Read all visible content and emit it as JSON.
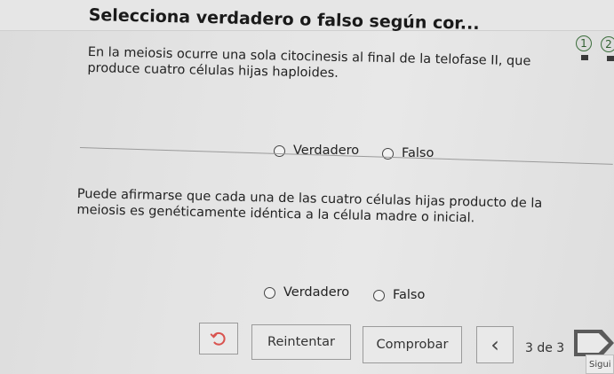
{
  "header": {
    "title": "Selecciona verdadero o falso según cor..."
  },
  "progress": {
    "steps": [
      "1",
      "2"
    ]
  },
  "questions": [
    {
      "text": "En la meiosis ocurre una sola citocinesis al final de la telofase II, que produce cuatro células hijas haploides.",
      "options": [
        "Verdadero",
        "Falso"
      ]
    },
    {
      "text": "Puede afirmarse que cada una de las cuatro células hijas producto de la meiosis es genéticamente idéntica a la célula madre o inicial.",
      "options": [
        "Verdadero",
        "Falso"
      ]
    }
  ],
  "footer": {
    "undo_icon": "undo-icon",
    "retry_label": "Reintentar",
    "check_label": "Comprobar",
    "prev_icon": "chevron-left-icon",
    "prev_glyph": "‹",
    "counter": "3 de 3",
    "next_label": "Sigui"
  }
}
